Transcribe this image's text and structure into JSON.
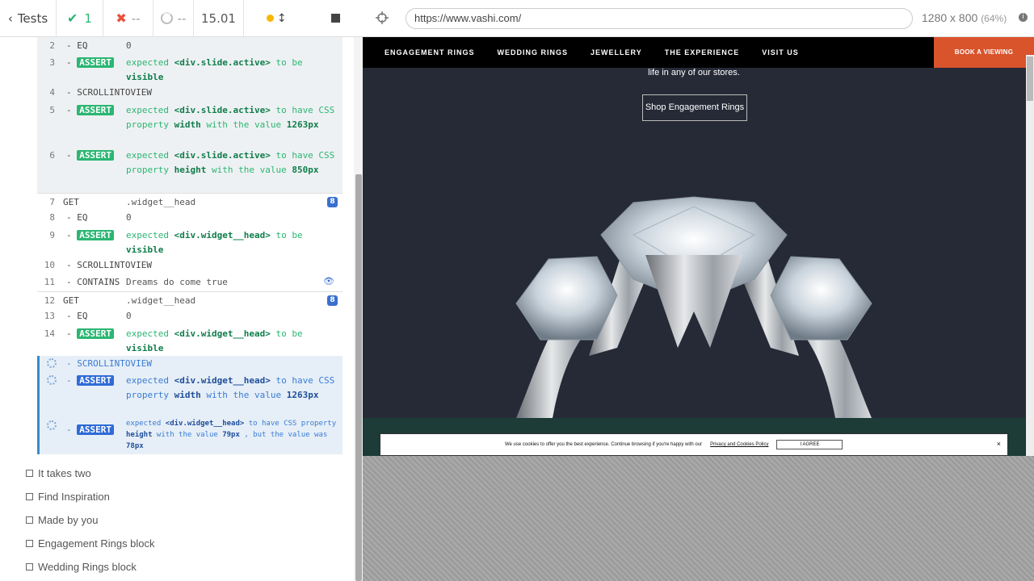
{
  "header": {
    "tests_label": "Tests",
    "passed": "1",
    "failed": "--",
    "pending": "--",
    "duration": "15.01"
  },
  "address": {
    "url": "https://www.vashi.com/",
    "viewport": "1280 x 800",
    "scale": "(64%)"
  },
  "log": {
    "rows": [
      {
        "num": "2",
        "name": "- EQ",
        "msg": "0"
      },
      {
        "num": "3",
        "name": "- ASSERT",
        "msg": "expected <div.slide.active> to be visible"
      },
      {
        "num": "4",
        "name": "- SCROLLINTOVIEW",
        "msg": ""
      },
      {
        "num": "5",
        "name": "- ASSERT",
        "msg": "expected <div.slide.active> to have CSS property width with the value 1263px"
      },
      {
        "num": "6",
        "name": "- ASSERT",
        "msg": "expected <div.slide.active> to have CSS property height with the value 850px"
      },
      {
        "num": "7",
        "name": "GET",
        "msg": ".widget__head",
        "badge": "8"
      },
      {
        "num": "8",
        "name": "- EQ",
        "msg": "0"
      },
      {
        "num": "9",
        "name": "- ASSERT",
        "msg": "expected <div.widget__head> to be visible"
      },
      {
        "num": "10",
        "name": "- SCROLLINTOVIEW",
        "msg": ""
      },
      {
        "num": "11",
        "name": "- CONTAINS",
        "msg": "Dreams do come true"
      },
      {
        "num": "12",
        "name": "GET",
        "msg": ".widget__head",
        "badge": "8"
      },
      {
        "num": "13",
        "name": "- EQ",
        "msg": "0"
      },
      {
        "num": "14",
        "name": "- ASSERT",
        "msg": "expected <div.widget__head> to be visible"
      },
      {
        "num": "",
        "name": "- SCROLLINTOVIEW",
        "msg": ""
      },
      {
        "num": "",
        "name": "- ASSERT",
        "msg": "expected <div.widget__head> to have CSS property width with the value 1263px"
      },
      {
        "num": "",
        "name": "- ASSERT",
        "msg": "expected <div.widget__head> to have CSS property height with the value 79px , but the value was 78px"
      }
    ],
    "tests": [
      "It takes two",
      "Find Inspiration",
      "Made by you",
      "Engagement Rings block",
      "Wedding Rings block"
    ]
  },
  "site": {
    "nav": [
      "ENGAGEMENT RINGS",
      "WEDDING RINGS",
      "JEWELLERY",
      "THE EXPERIENCE",
      "VISIT US"
    ],
    "book": "BOOK A VIEWING",
    "hero_text": "life in any of our stores.",
    "shop_button": "Shop Engagement Rings",
    "cookie_text": "We use cookies to offer you the best experience. Continue browsing if you're happy with our",
    "cookie_link": "Privacy and Cookies Policy",
    "cookie_agree": "I AGREE",
    "cookie_close": "×"
  },
  "icons": {
    "back": "chevron-left-icon",
    "pass": "check-icon",
    "fail": "x-icon",
    "pending": "circle-icon",
    "eye": "eye-icon"
  }
}
